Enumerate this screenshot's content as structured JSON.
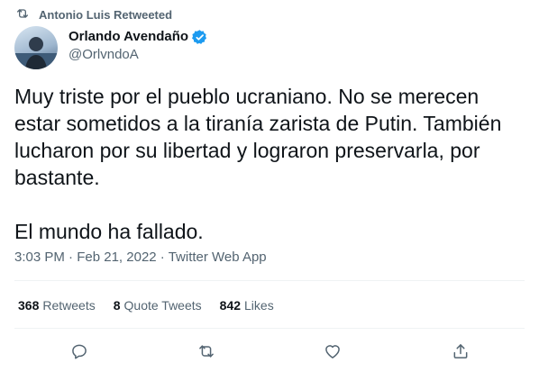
{
  "retweet_banner": {
    "text": "Antonio Luis Retweeted",
    "icon": "retweet-icon"
  },
  "author": {
    "name": "Orlando Avendaño",
    "handle": "@OrlvndoA",
    "verified": true,
    "verified_color": "#1d9bf0"
  },
  "tweet": {
    "paragraph1": "Muy triste por el pueblo ucraniano. No se merecen estar sometidos a la tiranía zarista de Putin. También lucharon por su libertad y lograron preservarla, por bastante.",
    "paragraph2": "El mundo ha fallado."
  },
  "meta": {
    "time": "3:03 PM",
    "separator": " · ",
    "date": "Feb 21, 2022",
    "source": "Twitter Web App"
  },
  "stats": {
    "retweets_count": "368",
    "retweets_label": "Retweets",
    "quotes_count": "8",
    "quotes_label": "Quote Tweets",
    "likes_count": "842",
    "likes_label": "Likes"
  },
  "actions": [
    "reply-icon",
    "retweet-icon",
    "like-icon",
    "share-icon"
  ],
  "colors": {
    "text": "#0f1419",
    "secondary": "#536471",
    "divider": "#eff3f4"
  }
}
